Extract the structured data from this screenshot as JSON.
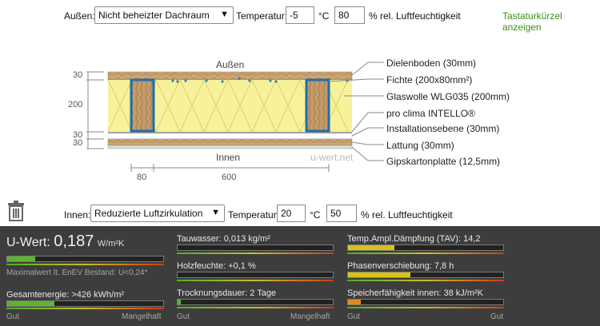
{
  "top": {
    "outside_label": "Außen:",
    "outside_select": "Nicht beheizter Dachraum",
    "temp_label": "Temperatur:",
    "temp_value": "-5",
    "temp_unit": "°C",
    "humidity_value": "80",
    "humidity_unit": "% rel. Luftfeuchtigkeit",
    "shortcuts_link": "Tastaturkürzel anzeigen"
  },
  "diagram": {
    "outside_text": "Außen",
    "inside_text": "Innen",
    "watermark": "u-wert.net",
    "left_dims": [
      "30",
      "200",
      "30",
      "30"
    ],
    "bottom_dims": [
      "80",
      "600"
    ],
    "layers": [
      "Dielenboden (30mm)",
      "Fichte (200x80mm²)",
      "Glaswolle WLG035 (200mm)",
      "pro clima INTELLO®",
      "Installationsebene (30mm)",
      "Lattung (30mm)",
      "Gipskartonplatte (12,5mm)"
    ]
  },
  "bottom": {
    "inside_label": "Innen:",
    "inside_select": "Reduzierte Luftzirkulation",
    "temp_label": "Temperatur:",
    "temp_value": "20",
    "temp_unit": "°C",
    "humidity_value": "50",
    "humidity_unit": "% rel. Luftfeuchtigkeit"
  },
  "results": {
    "uwert_label": "U-Wert:",
    "uwert_value": "0,187",
    "uwert_unit": "W/m²K",
    "uwert_fill": 0.18,
    "uwert_note": "Maximalwert lt. EnEV Bestand: U<0,24*",
    "gesamt": "Gesamtenergie: >426 kWh/m²",
    "gesamt_fill": 0.3,
    "gut": "Gut",
    "mangelhaft": "Mangelhaft",
    "tauwasser": "Tauwasser: 0,013 kg/m²",
    "tauwasser_fill": 0.0,
    "holz": "Holzfeuchte: +0,1 %",
    "holz_fill": 0.0,
    "trock": "Trocknungsdauer: 2 Tage",
    "trock_fill": 0.02,
    "tav": "Temp.Ampl.Dämpfung (TAV): 14,2",
    "tav_fill": 0.3,
    "phase": "Phasenverschiebung: 7,8 h",
    "phase_fill": 0.4,
    "speicher": "Speicherfähigkeit innen: 38 kJ/m²K",
    "speicher_fill": 0.08,
    "colors": {
      "green": "#5db52e",
      "yellow": "#d7c21a",
      "orange": "#e08a1c"
    }
  }
}
